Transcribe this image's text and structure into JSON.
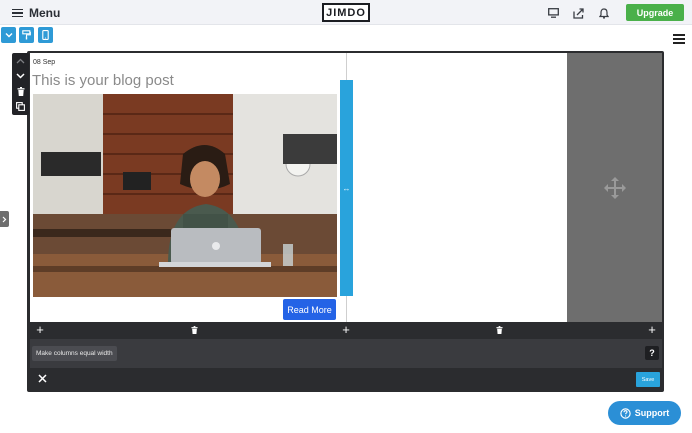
{
  "topbar": {
    "menu_label": "Menu",
    "logo": "JIMDO",
    "icons": [
      "desktop-icon",
      "share-icon",
      "bell-icon"
    ],
    "upgrade_label": "Upgrade"
  },
  "view_toggles": [
    "chevron-down-icon",
    "paint-roller-icon",
    "mobile-icon"
  ],
  "post": {
    "date": "08 Sep",
    "title": "This is your blog post",
    "read_more_label": "Read More"
  },
  "toolbar": {
    "equal_width_label": "Make columns equal width",
    "help_label": "?",
    "save_label": "Save"
  },
  "support": {
    "label": "Support"
  },
  "colors": {
    "accent_blue": "#29a3dc",
    "upgrade_green": "#4ab04a",
    "read_more_blue": "#2463e6",
    "frame_dark": "#2b2c2f"
  }
}
